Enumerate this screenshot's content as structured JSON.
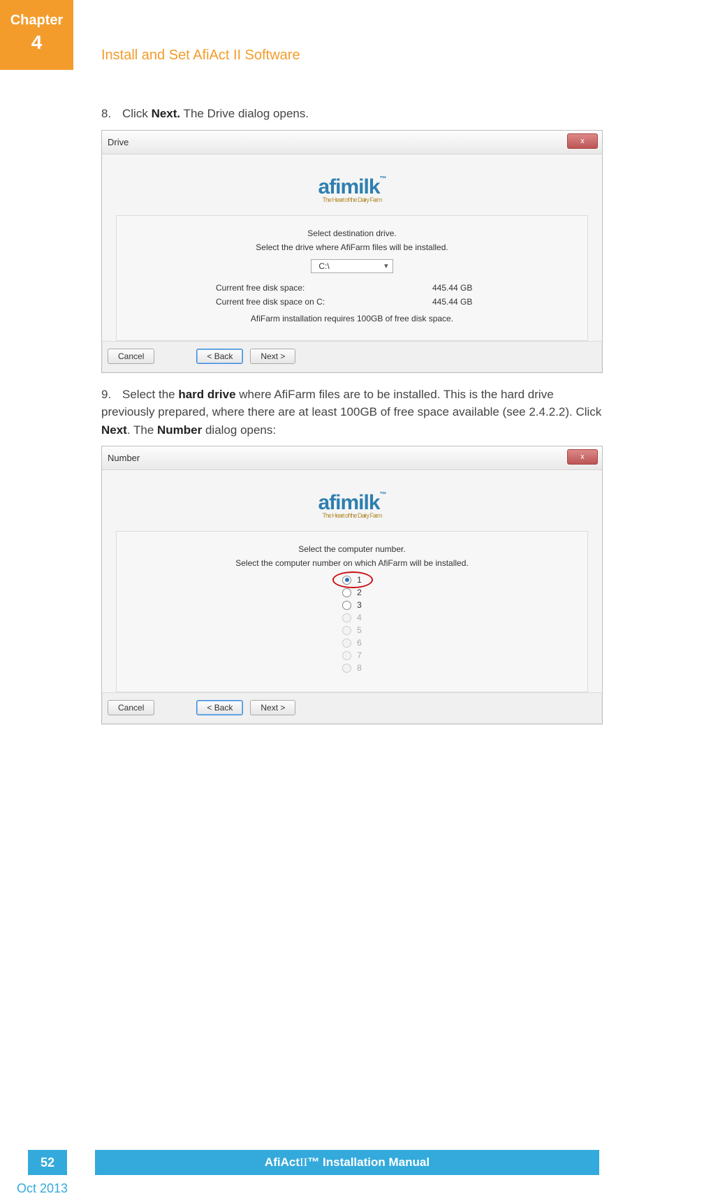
{
  "header": {
    "chapter_label": "Chapter",
    "chapter_number": "4",
    "section_title": "Install and Set AfiAct II Software"
  },
  "step8": {
    "number": "8.",
    "pre": "Click ",
    "bold": "Next.",
    "post": " The Drive dialog opens."
  },
  "drive_dialog": {
    "title": "Drive",
    "close": "x",
    "logo_main": "afimilk",
    "logo_tm": "™",
    "logo_tag": "The Heart of the Dairy Farm",
    "line1": "Select destination drive.",
    "line2": "Select the drive where AfiFarm files will be installed.",
    "selected_drive": "C:\\",
    "row1_label": "Current free disk space:",
    "row1_value": "445.44 GB",
    "row2_label": "Current free disk space on C:",
    "row2_value": "445.44 GB",
    "req": "AfiFarm installation requires 100GB of free disk space.",
    "btn_cancel": "Cancel",
    "btn_back": "<  Back",
    "btn_next": "Next >"
  },
  "step9": {
    "number": "9.",
    "t1": "Select the ",
    "b1": "hard drive",
    "t2": " where AfiFarm files are to be installed. This is the hard drive previously prepared, where there are at least 100GB of free space available (see 2.4.2.2). Click ",
    "b2": "Next",
    "t3": ". The ",
    "b3": "Number",
    "t4": " dialog opens:"
  },
  "number_dialog": {
    "title": "Number",
    "close": "x",
    "logo_main": "afimilk",
    "logo_tm": "™",
    "logo_tag": "The Heart of the Dairy Farm",
    "line1": "Select the computer number.",
    "line2": "Select the computer number on which AfiFarm will be installed.",
    "options": [
      {
        "label": "1",
        "selected": true,
        "disabled": false,
        "highlight": true
      },
      {
        "label": "2",
        "selected": false,
        "disabled": false,
        "highlight": false
      },
      {
        "label": "3",
        "selected": false,
        "disabled": false,
        "highlight": false
      },
      {
        "label": "4",
        "selected": false,
        "disabled": true,
        "highlight": false
      },
      {
        "label": "5",
        "selected": false,
        "disabled": true,
        "highlight": false
      },
      {
        "label": "6",
        "selected": false,
        "disabled": true,
        "highlight": false
      },
      {
        "label": "7",
        "selected": false,
        "disabled": true,
        "highlight": false
      },
      {
        "label": "8",
        "selected": false,
        "disabled": true,
        "highlight": false
      }
    ],
    "btn_cancel": "Cancel",
    "btn_back": "<  Back",
    "btn_next": "Next >"
  },
  "footer": {
    "page_number": "52",
    "manual_pre": "AfiAct ",
    "manual_ii": "II",
    "manual_post": "™ Installation Manual",
    "date": "Oct 2013"
  }
}
